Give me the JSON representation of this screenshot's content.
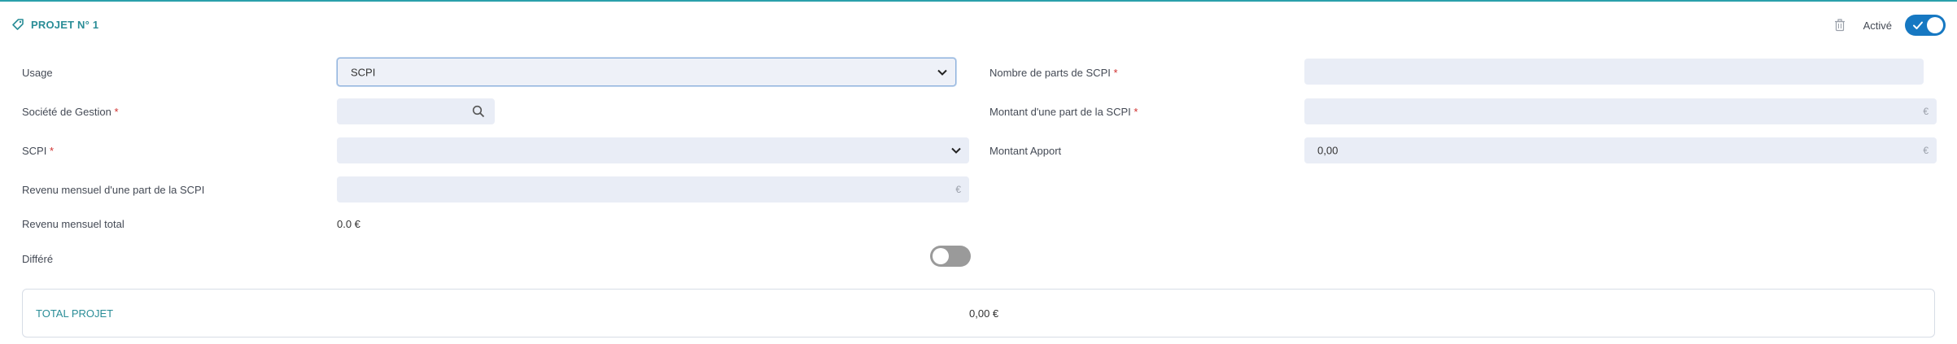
{
  "header": {
    "title": "PROJET N° 1",
    "active_label": "Activé",
    "active_toggle": true
  },
  "form": {
    "usage": {
      "label": "Usage",
      "value": "SCPI"
    },
    "societe_gestion": {
      "label": "Société de Gestion",
      "required_mark": "*",
      "value": ""
    },
    "scpi": {
      "label": "SCPI",
      "required_mark": "*",
      "value": ""
    },
    "revenu_mensuel_part": {
      "label": "Revenu mensuel d'une part de la SCPI",
      "value": "",
      "unit": "€"
    },
    "revenu_mensuel_total": {
      "label": "Revenu mensuel total",
      "value": "0.0 €"
    },
    "differe": {
      "label": "Différé",
      "toggle": false
    },
    "nombre_parts": {
      "label": "Nombre de parts de SCPI",
      "required_mark": "*",
      "value": ""
    },
    "montant_part": {
      "label": "Montant d'une part de la SCPI",
      "required_mark": "*",
      "value": "",
      "unit": "€"
    },
    "montant_apport": {
      "label": "Montant Apport",
      "value": "0,00",
      "unit": "€"
    }
  },
  "total": {
    "label": "TOTAL PROJET",
    "value": "0,00 €"
  },
  "colors": {
    "accent": "#2a8d97",
    "toggle_on": "#1678c2",
    "field_bg": "#e9edf6",
    "required": "#d0302f"
  }
}
